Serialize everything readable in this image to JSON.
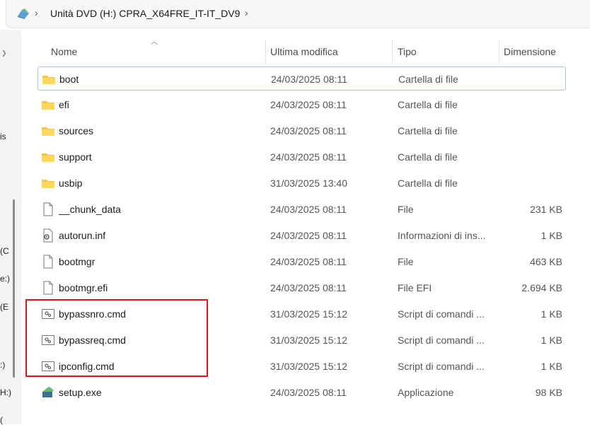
{
  "address": {
    "path_text": "Unità DVD (H:) CPRA_X64FRE_IT-IT_DV9",
    "drive_icon": "dvd-drive-icon"
  },
  "nav_fragments": [
    "is",
    "(C",
    "e:)",
    "(E",
    ":)",
    "H:)",
    "("
  ],
  "columns": {
    "name": "Nome",
    "modified": "Ultima modifica",
    "type": "Tipo",
    "size": "Dimensione"
  },
  "files": [
    {
      "name": "boot",
      "modified": "24/03/2025 08:11",
      "type": "Cartella di file",
      "size": "",
      "icon": "folder-icon"
    },
    {
      "name": "efi",
      "modified": "24/03/2025 08:11",
      "type": "Cartella di file",
      "size": "",
      "icon": "folder-icon"
    },
    {
      "name": "sources",
      "modified": "24/03/2025 08:11",
      "type": "Cartella di file",
      "size": "",
      "icon": "folder-icon"
    },
    {
      "name": "support",
      "modified": "24/03/2025 08:11",
      "type": "Cartella di file",
      "size": "",
      "icon": "folder-icon"
    },
    {
      "name": "usbip",
      "modified": "31/03/2025 13:40",
      "type": "Cartella di file",
      "size": "",
      "icon": "folder-icon"
    },
    {
      "name": "__chunk_data",
      "modified": "24/03/2025 08:11",
      "type": "File",
      "size": "231 KB",
      "icon": "file-icon"
    },
    {
      "name": "autorun.inf",
      "modified": "24/03/2025 08:11",
      "type": "Informazioni di ins...",
      "size": "1 KB",
      "icon": "settings-file-icon"
    },
    {
      "name": "bootmgr",
      "modified": "24/03/2025 08:11",
      "type": "File",
      "size": "463 KB",
      "icon": "file-icon"
    },
    {
      "name": "bootmgr.efi",
      "modified": "24/03/2025 08:11",
      "type": "File EFI",
      "size": "2.694 KB",
      "icon": "file-icon"
    },
    {
      "name": "bypassnro.cmd",
      "modified": "31/03/2025 15:12",
      "type": "Script di comandi ...",
      "size": "1 KB",
      "icon": "cmd-script-icon"
    },
    {
      "name": "bypassreq.cmd",
      "modified": "31/03/2025 15:12",
      "type": "Script di comandi ...",
      "size": "1 KB",
      "icon": "cmd-script-icon"
    },
    {
      "name": "ipconfig.cmd",
      "modified": "31/03/2025 15:12",
      "type": "Script di comandi ...",
      "size": "1 KB",
      "icon": "cmd-script-icon"
    },
    {
      "name": "setup.exe",
      "modified": "24/03/2025 08:11",
      "type": "Applicazione",
      "size": "98 KB",
      "icon": "setup-app-icon"
    }
  ],
  "colors": {
    "highlight": "#e0141e",
    "folder": "#f4c542",
    "selection_border": "#99c9ef"
  }
}
